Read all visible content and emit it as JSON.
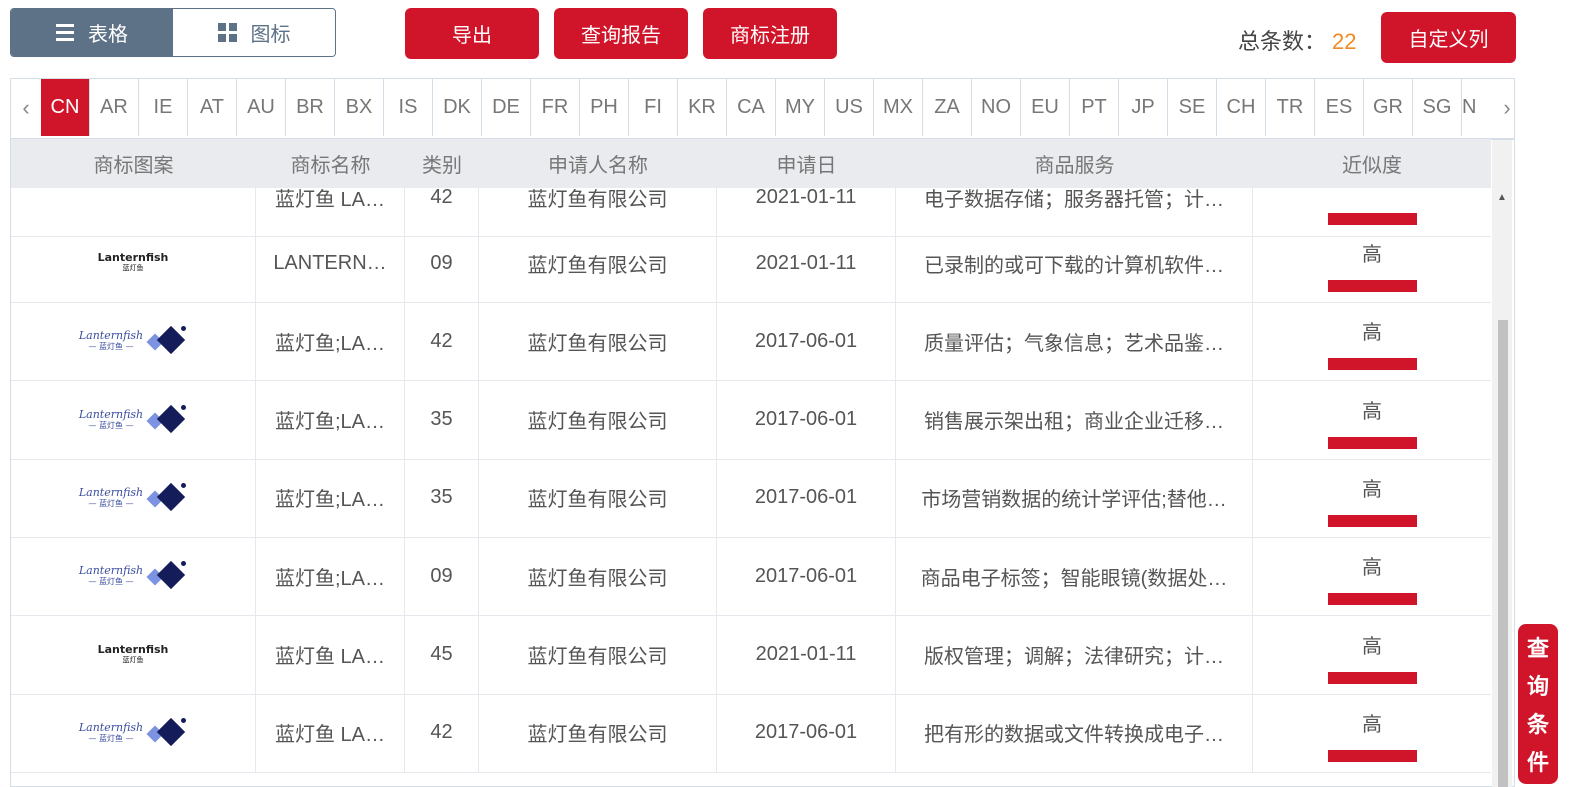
{
  "view_toggle": {
    "table_label": "表格",
    "icon_label": "图标"
  },
  "toolbar": {
    "export": "导出",
    "query_report": "查询报告",
    "register": "商标注册",
    "custom_cols": "自定义列"
  },
  "total": {
    "label": "总条数：",
    "value": "22"
  },
  "countries": [
    "CN",
    "AR",
    "IE",
    "AT",
    "AU",
    "BR",
    "BX",
    "IS",
    "DK",
    "DE",
    "FR",
    "PH",
    "FI",
    "KR",
    "CA",
    "MY",
    "US",
    "MX",
    "ZA",
    "NO",
    "EU",
    "PT",
    "JP",
    "SE",
    "CH",
    "TR",
    "ES",
    "GR",
    "SG",
    "N"
  ],
  "headers": {
    "pattern": "商标图案",
    "name": "商标名称",
    "class": "类别",
    "applicant": "申请人名称",
    "date": "申请日",
    "goods": "商品服务",
    "similarity": "近似度"
  },
  "partial_row": {
    "name": "蓝灯鱼 LA…",
    "class": "42",
    "applicant": "蓝灯鱼有限公司",
    "date": "2021-01-11",
    "goods": "电子数据存储；服务器托管；计…"
  },
  "rows": [
    {
      "logo": "dark",
      "logo_text": "Lanternfish",
      "logo_cn": "蓝灯鱼",
      "name": "LANTERN…",
      "class": "09",
      "applicant": "蓝灯鱼有限公司",
      "date": "2021-01-11",
      "goods": "已录制的或可下载的计算机软件…",
      "similarity": "高"
    },
    {
      "logo": "blue",
      "logo_text": "Lanternfish",
      "logo_cn": "— 蓝灯鱼 —",
      "name": "蓝灯鱼;LA…",
      "class": "42",
      "applicant": "蓝灯鱼有限公司",
      "date": "2017-06-01",
      "goods": "质量评估；气象信息；艺术品鉴…",
      "similarity": "高"
    },
    {
      "logo": "blue",
      "logo_text": "Lanternfish",
      "logo_cn": "— 蓝灯鱼 —",
      "name": "蓝灯鱼;LA…",
      "class": "35",
      "applicant": "蓝灯鱼有限公司",
      "date": "2017-06-01",
      "goods": "销售展示架出租；商业企业迁移…",
      "similarity": "高"
    },
    {
      "logo": "blue",
      "logo_text": "Lanternfish",
      "logo_cn": "— 蓝灯鱼 —",
      "name": "蓝灯鱼;LA…",
      "class": "35",
      "applicant": "蓝灯鱼有限公司",
      "date": "2017-06-01",
      "goods": "市场营销数据的统计学评估;替他…",
      "similarity": "高"
    },
    {
      "logo": "blue",
      "logo_text": "Lanternfish",
      "logo_cn": "— 蓝灯鱼 —",
      "name": "蓝灯鱼;LA…",
      "class": "09",
      "applicant": "蓝灯鱼有限公司",
      "date": "2017-06-01",
      "goods": "商品电子标签；智能眼镜(数据处…",
      "similarity": "高"
    },
    {
      "logo": "dark",
      "logo_text": "Lanternfish",
      "logo_cn": "蓝灯鱼",
      "name": "蓝灯鱼 LA…",
      "class": "45",
      "applicant": "蓝灯鱼有限公司",
      "date": "2021-01-11",
      "goods": "版权管理；调解；法律研究；计…",
      "similarity": "高"
    },
    {
      "logo": "blue",
      "logo_text": "Lanternfish",
      "logo_cn": "— 蓝灯鱼 —",
      "name": "蓝灯鱼 LA…",
      "class": "42",
      "applicant": "蓝灯鱼有限公司",
      "date": "2017-06-01",
      "goods": "把有形的数据或文件转换成电子…",
      "similarity": "高"
    }
  ],
  "side_button": {
    "chars": [
      "查",
      "询",
      "条",
      "件"
    ]
  },
  "colors": {
    "accent": "#d0152a",
    "toggle": "#5d7286",
    "total_num": "#f08a24"
  }
}
